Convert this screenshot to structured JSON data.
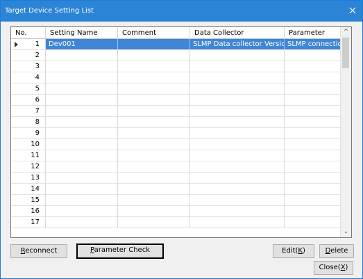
{
  "window": {
    "title": "Target Device Setting List",
    "close_icon": "close-icon"
  },
  "columns": [
    {
      "key": "no",
      "label": "No."
    },
    {
      "key": "setting_name",
      "label": "Setting Name"
    },
    {
      "key": "comment",
      "label": "Comment"
    },
    {
      "key": "data_collector",
      "label": "Data Collector"
    },
    {
      "key": "parameter",
      "label": "Parameter"
    }
  ],
  "rows": [
    {
      "no": "1",
      "setting_name": "Dev001",
      "comment": "",
      "data_collector": "SLMP Data collector Versio...",
      "parameter": "SLMP connection ...",
      "selected": true
    },
    {
      "no": "2",
      "setting_name": "",
      "comment": "",
      "data_collector": "",
      "parameter": ""
    },
    {
      "no": "3",
      "setting_name": "",
      "comment": "",
      "data_collector": "",
      "parameter": ""
    },
    {
      "no": "4",
      "setting_name": "",
      "comment": "",
      "data_collector": "",
      "parameter": ""
    },
    {
      "no": "5",
      "setting_name": "",
      "comment": "",
      "data_collector": "",
      "parameter": ""
    },
    {
      "no": "6",
      "setting_name": "",
      "comment": "",
      "data_collector": "",
      "parameter": ""
    },
    {
      "no": "7",
      "setting_name": "",
      "comment": "",
      "data_collector": "",
      "parameter": ""
    },
    {
      "no": "8",
      "setting_name": "",
      "comment": "",
      "data_collector": "",
      "parameter": ""
    },
    {
      "no": "9",
      "setting_name": "",
      "comment": "",
      "data_collector": "",
      "parameter": ""
    },
    {
      "no": "10",
      "setting_name": "",
      "comment": "",
      "data_collector": "",
      "parameter": ""
    },
    {
      "no": "11",
      "setting_name": "",
      "comment": "",
      "data_collector": "",
      "parameter": ""
    },
    {
      "no": "12",
      "setting_name": "",
      "comment": "",
      "data_collector": "",
      "parameter": ""
    },
    {
      "no": "13",
      "setting_name": "",
      "comment": "",
      "data_collector": "",
      "parameter": ""
    },
    {
      "no": "14",
      "setting_name": "",
      "comment": "",
      "data_collector": "",
      "parameter": ""
    },
    {
      "no": "15",
      "setting_name": "",
      "comment": "",
      "data_collector": "",
      "parameter": ""
    },
    {
      "no": "16",
      "setting_name": "",
      "comment": "",
      "data_collector": "",
      "parameter": ""
    },
    {
      "no": "17",
      "setting_name": "",
      "comment": "",
      "data_collector": "",
      "parameter": ""
    }
  ],
  "buttons": {
    "reconnect": {
      "first": "R",
      "rest": "econnect"
    },
    "parameter_check": {
      "first": "P",
      "rest": "arameter Check"
    },
    "edit": {
      "pre": "Edit(",
      "key": "K",
      "post": ")"
    },
    "delete": {
      "first": "D",
      "rest": "elete"
    },
    "close": {
      "pre": "Close(",
      "key": "X",
      "post": ")"
    }
  },
  "colors": {
    "titlebar": "#2b84d6",
    "selection": "#3f86d6"
  }
}
